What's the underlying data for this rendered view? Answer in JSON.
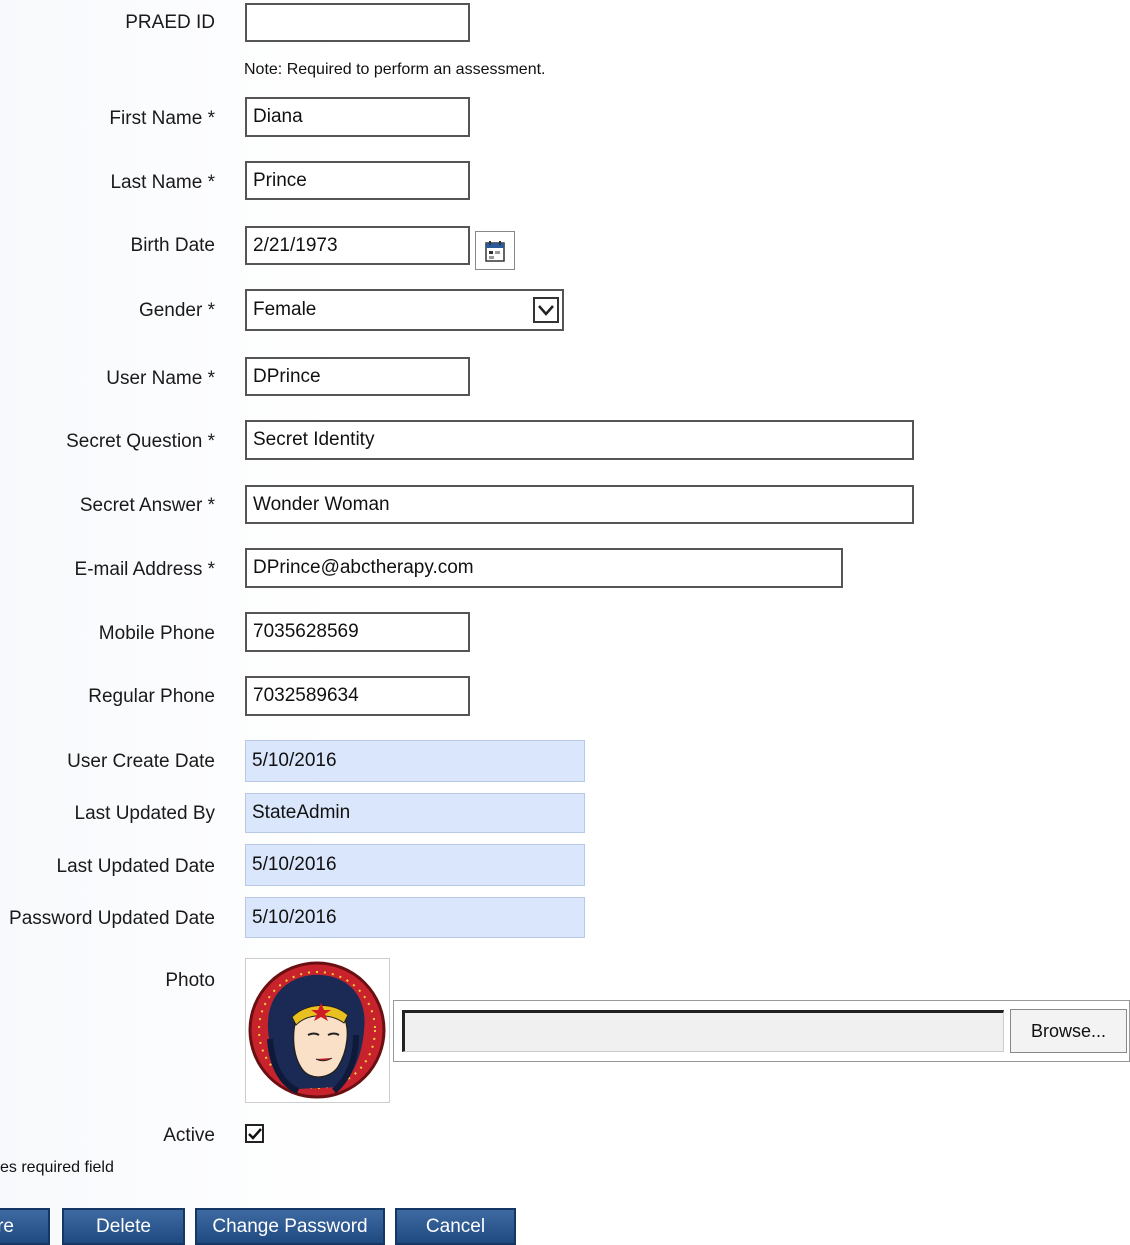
{
  "form": {
    "praed_id": {
      "label": "PRAED ID",
      "value": ""
    },
    "note": "Note: Required to perform an assessment.",
    "first_name": {
      "label": "First Name *",
      "value": "Diana"
    },
    "last_name": {
      "label": "Last Name *",
      "value": "Prince"
    },
    "birth_date": {
      "label": "Birth Date",
      "value": "2/21/1973"
    },
    "gender": {
      "label": "Gender *",
      "value": "Female"
    },
    "user_name": {
      "label": "User Name *",
      "value": "DPrince"
    },
    "secret_question": {
      "label": "Secret Question *",
      "value": "Secret Identity"
    },
    "secret_answer": {
      "label": "Secret Answer *",
      "value": "Wonder Woman"
    },
    "email": {
      "label": "E-mail Address *",
      "value": "DPrince@abctherapy.com"
    },
    "mobile_phone": {
      "label": "Mobile Phone",
      "value": "7035628569"
    },
    "regular_phone": {
      "label": "Regular Phone",
      "value": "7032589634"
    },
    "user_create_date": {
      "label": "User Create Date",
      "value": "5/10/2016"
    },
    "last_updated_by": {
      "label": "Last Updated By",
      "value": "StateAdmin"
    },
    "last_updated_date": {
      "label": "Last Updated Date",
      "value": "5/10/2016"
    },
    "password_updated_date": {
      "label": "Password Updated Date",
      "value": "5/10/2016"
    },
    "photo": {
      "label": "Photo",
      "browse_label": "Browse...",
      "file_value": ""
    },
    "active": {
      "label": "Active",
      "checked": true
    },
    "required_note": "es required field"
  },
  "buttons": {
    "save": "re",
    "delete": "Delete",
    "change_password": "Change Password",
    "cancel": "Cancel"
  },
  "icons": {
    "calendar": "calendar-icon",
    "dropdown": "chevron-down-icon",
    "checkbox": "checkmark-icon"
  },
  "colors": {
    "readonly_bg": "#d9e6fb",
    "button_bg": "#2b5890"
  }
}
